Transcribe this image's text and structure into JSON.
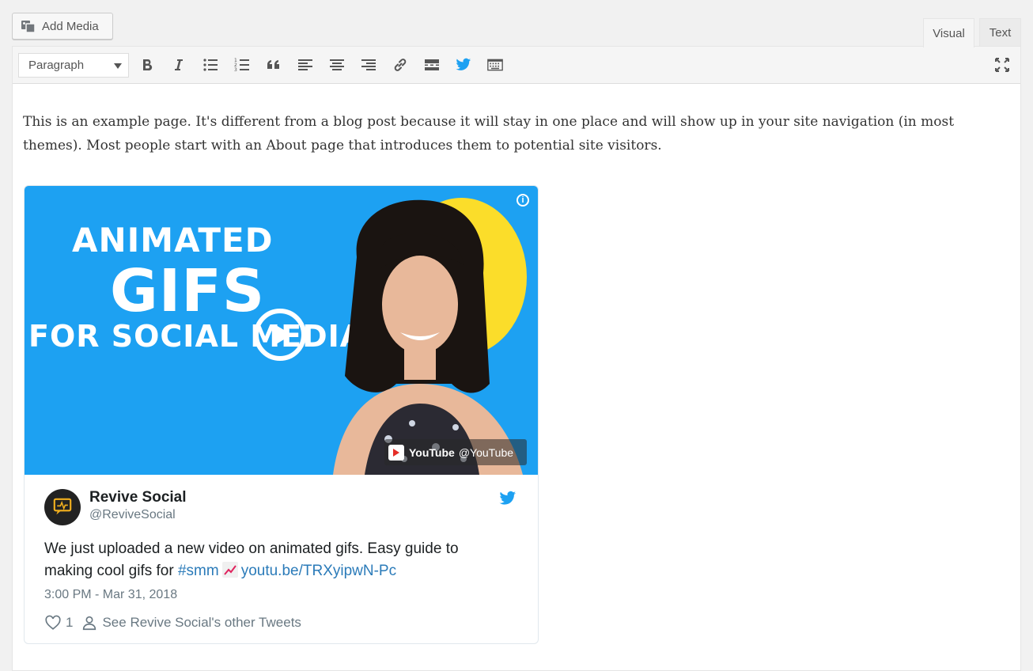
{
  "header": {
    "add_media_label": "Add Media",
    "tabs": [
      {
        "label": "Visual",
        "active": true
      },
      {
        "label": "Text",
        "active": false
      }
    ]
  },
  "toolbar": {
    "format_select_value": "Paragraph",
    "buttons": [
      {
        "name": "bold",
        "icon": "bold-icon"
      },
      {
        "name": "italic",
        "icon": "italic-icon"
      },
      {
        "name": "bulleted-list",
        "icon": "bulleted-list-icon"
      },
      {
        "name": "numbered-list",
        "icon": "numbered-list-icon"
      },
      {
        "name": "blockquote",
        "icon": "quote-icon"
      },
      {
        "name": "align-left",
        "icon": "align-left-icon"
      },
      {
        "name": "align-center",
        "icon": "align-center-icon"
      },
      {
        "name": "align-right",
        "icon": "align-right-icon"
      },
      {
        "name": "insert-link",
        "icon": "link-icon"
      },
      {
        "name": "read-more",
        "icon": "read-more-icon"
      },
      {
        "name": "twitter",
        "icon": "twitter-icon"
      },
      {
        "name": "toolbar-toggle",
        "icon": "keyboard-icon"
      },
      {
        "name": "fullscreen",
        "icon": "fullscreen-icon"
      }
    ]
  },
  "content": {
    "paragraph": "This is an example page. It's different from a blog post because it will stay in one place and will show up in your site navigation (in most themes). Most people start with an About page that introduces them to potential site visitors."
  },
  "embed": {
    "video": {
      "title_line1": "ANIMATED",
      "title_line2": "GIFS",
      "title_line3": "FOR SOCIAL MEDIA",
      "source_name": "YouTube",
      "source_handle": "@YouTube"
    },
    "tweet": {
      "user_name": "Revive Social",
      "user_handle": "@ReviveSocial",
      "text_part1": "We just uploaded a new video on animated gifs. Easy guide to making cool gifs for",
      "hashtag": "#smm",
      "link": "youtu.be/TRXyipwN-Pc",
      "timestamp": "3:00 PM - Mar 31, 2018",
      "likes": "1",
      "other_tweets_label": "See Revive Social's other Tweets"
    }
  },
  "colors": {
    "twitter_blue": "#1da1f2",
    "link_blue": "#2b7bb9",
    "video_bg": "#1da1f2",
    "sun_yellow": "#fbdd2a"
  }
}
